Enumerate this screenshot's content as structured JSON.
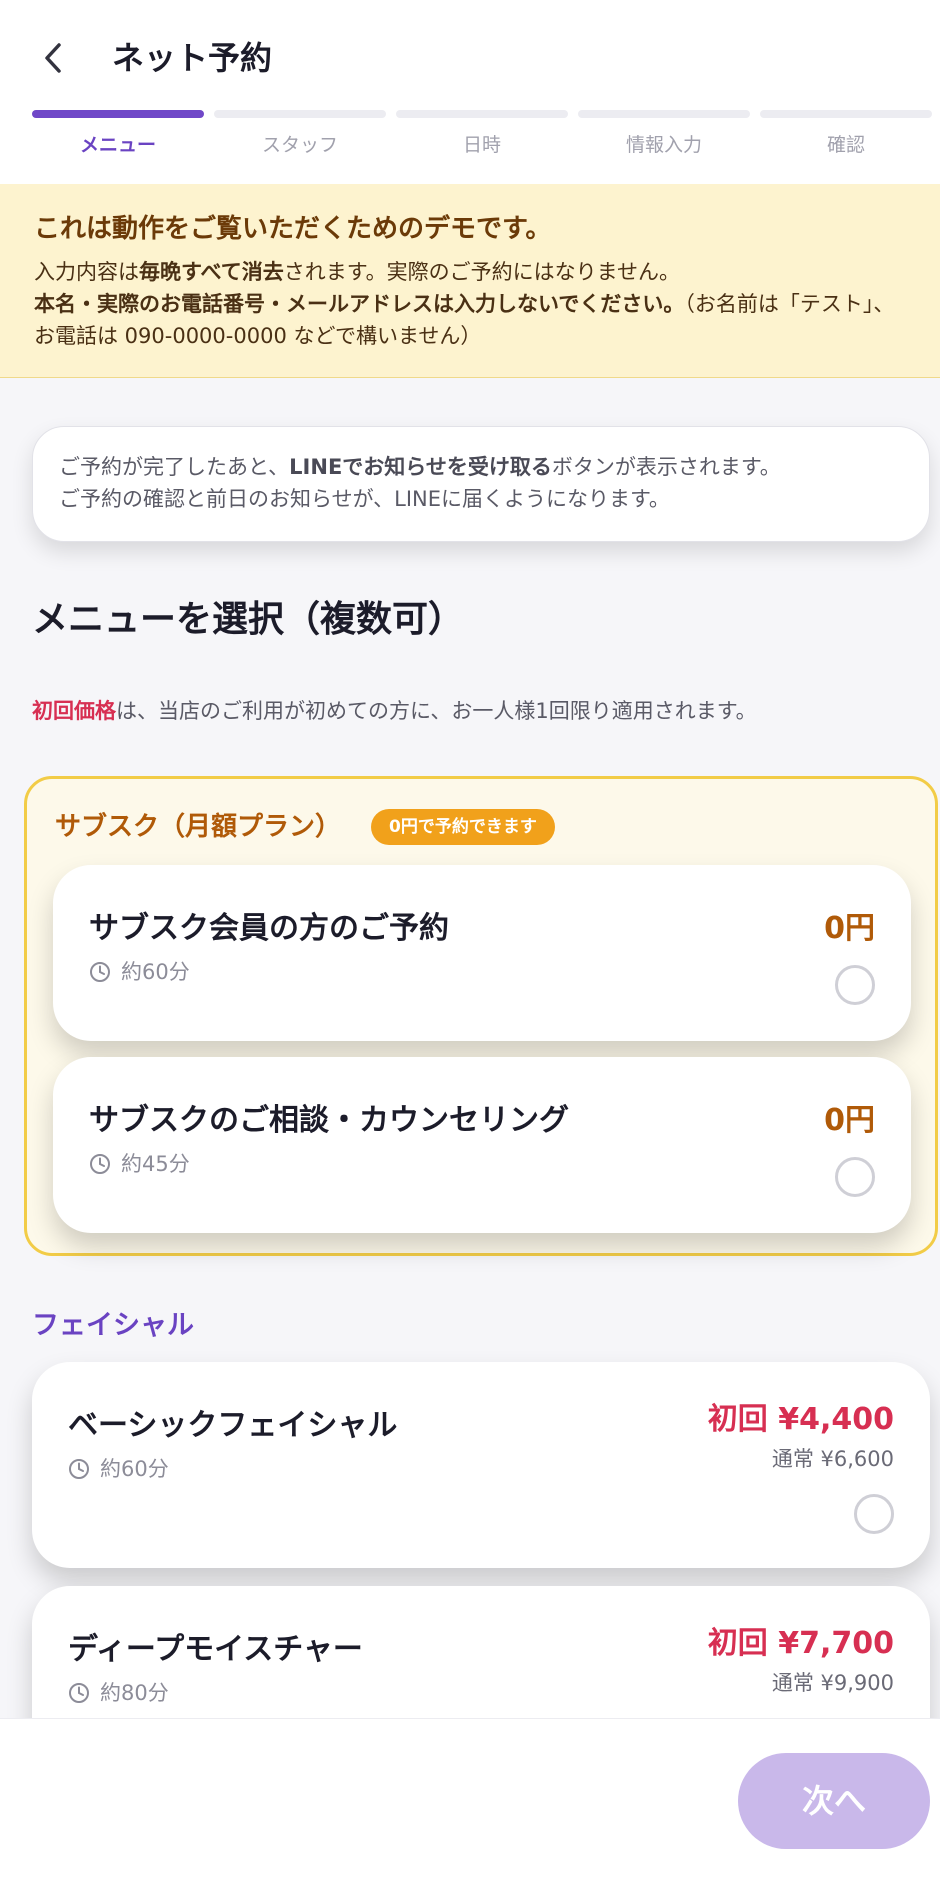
{
  "header": {
    "title": "ネット予約",
    "back_icon": "chevron-left-icon"
  },
  "steps": [
    {
      "label": "メニュー",
      "active": true
    },
    {
      "label": "スタッフ",
      "active": false
    },
    {
      "label": "日時",
      "active": false
    },
    {
      "label": "情報入力",
      "active": false
    },
    {
      "label": "確認",
      "active": false
    }
  ],
  "notice": {
    "title": "これは動作をご覧いただくためのデモです。",
    "line1_pre": "入力内容は",
    "line1_bold": "毎晩すべて消去",
    "line1_post": "されます。実際のご予約にはなりません。",
    "line2_bold": "本名・実際のお電話番号・メールアドレスは入力しないでください。",
    "line2_post": "（お名前は「テスト」、お電話は 090-0000-0000 などで構いません）"
  },
  "line_info": {
    "pre": "ご予約が完了したあと、",
    "bold": "LINEでお知らせを受け取る",
    "post": "ボタンが表示されます。",
    "line2": "ご予約の確認と前日のお知らせが、LINEに届くようになります。"
  },
  "menu_section": {
    "heading": "メニューを選択（複数可）",
    "note_highlight": "初回価格",
    "note_rest": "は、当店のご利用が初めての方に、お一人様1回限り適用されます。"
  },
  "subscription": {
    "title": "サブスク（月額プラン）",
    "badge": "0円で予約できます",
    "items": [
      {
        "name": "サブスク会員の方のご予約",
        "duration": "約60分",
        "price": "0円"
      },
      {
        "name": "サブスクのご相談・カウンセリング",
        "duration": "約45分",
        "price": "0円"
      }
    ]
  },
  "facial": {
    "heading": "フェイシャル",
    "items": [
      {
        "name": "ベーシックフェイシャル",
        "duration": "約60分",
        "first_price": "初回 ¥4,400",
        "regular_price": "通常 ¥6,600"
      },
      {
        "name": "ディープモイスチャー",
        "duration": "約80分",
        "first_price": "初回 ¥7,700",
        "regular_price": "通常 ¥9,900"
      }
    ]
  },
  "footer": {
    "next_label": "次へ"
  },
  "colors": {
    "accent_purple": "#7048c8",
    "first_price_red": "#d72f52",
    "subscription_orange": "#b05a08",
    "notice_bg": "#fdf3cf"
  }
}
